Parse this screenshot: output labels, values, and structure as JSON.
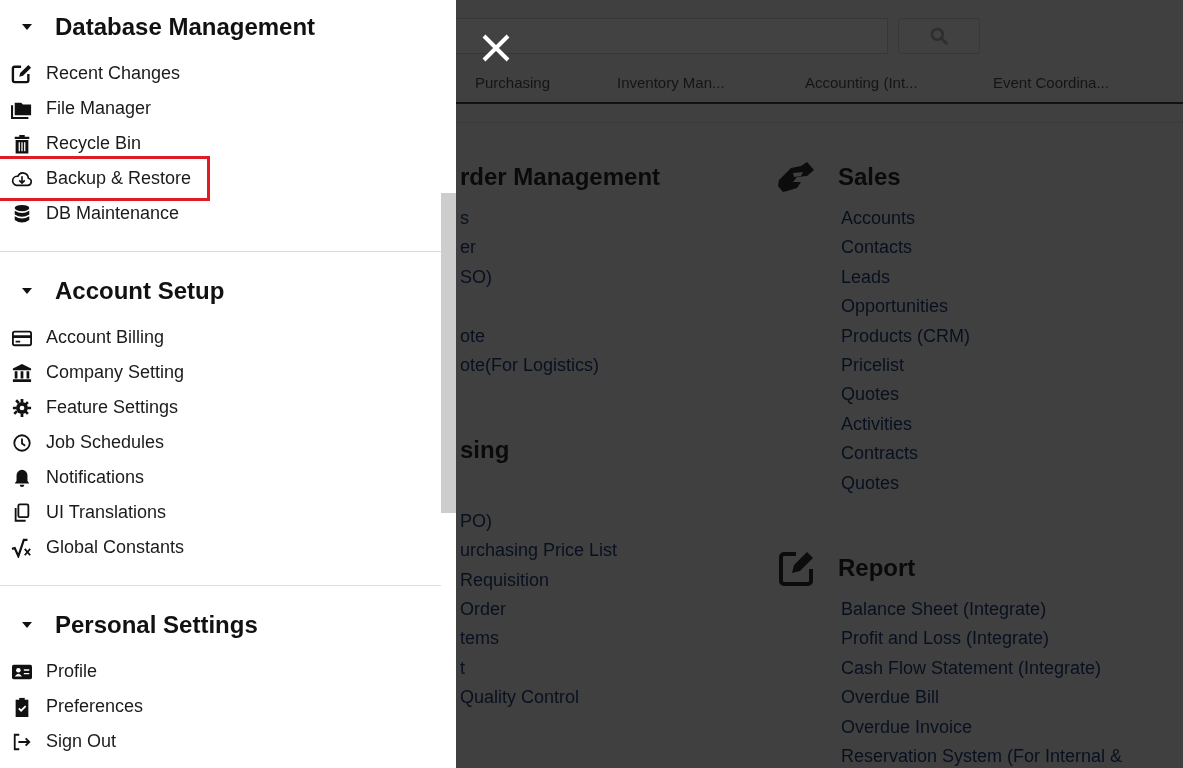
{
  "drawer": {
    "sections": [
      {
        "title": "Database Management",
        "expanded": true,
        "items": [
          {
            "label": "Recent Changes",
            "highlighted": false
          },
          {
            "label": "File Manager",
            "highlighted": false
          },
          {
            "label": "Recycle Bin",
            "highlighted": false
          },
          {
            "label": "Backup & Restore",
            "highlighted": true
          },
          {
            "label": "DB Maintenance",
            "highlighted": false
          }
        ]
      },
      {
        "title": "Account Setup",
        "expanded": true,
        "items": [
          {
            "label": "Account Billing",
            "highlighted": false
          },
          {
            "label": "Company Setting",
            "highlighted": false
          },
          {
            "label": "Feature Settings",
            "highlighted": false
          },
          {
            "label": "Job Schedules",
            "highlighted": false
          },
          {
            "label": "Notifications",
            "highlighted": false
          },
          {
            "label": "UI Translations",
            "highlighted": false
          },
          {
            "label": "Global Constants",
            "highlighted": false
          }
        ]
      },
      {
        "title": "Personal Settings",
        "expanded": true,
        "items": [
          {
            "label": "Profile",
            "highlighted": false
          },
          {
            "label": "Preferences",
            "highlighted": false
          },
          {
            "label": "Sign Out",
            "highlighted": false
          }
        ]
      }
    ]
  },
  "page": {
    "tabs": [
      {
        "label": "Purchasing",
        "selected": false
      },
      {
        "label": "Inventory Man...",
        "selected": false
      },
      {
        "label": "Accounting (Int...",
        "selected": false
      },
      {
        "label": "Event Coordina...",
        "selected": false
      }
    ],
    "left_column": [
      {
        "title": "rder Management",
        "links": [
          "s",
          "er",
          "SO)",
          "ote",
          "ote(For Logistics)"
        ]
      },
      {
        "title": "sing",
        "links": [
          "PO)",
          "urchasing Price List",
          "Requisition",
          "Order",
          "tems",
          "t",
          "Quality Control"
        ]
      }
    ],
    "right_column": [
      {
        "title": "Sales",
        "links": [
          "Accounts",
          "Contacts",
          "Leads",
          "Opportunities",
          "Products (CRM)",
          "Pricelist",
          "Quotes",
          "Activities",
          "Contracts",
          "Quotes"
        ]
      },
      {
        "title": "Report",
        "links": [
          "Balance Sheet (Integrate)",
          "Profit and Loss (Integrate)",
          "Cash Flow Statement (Integrate)",
          "Overdue Bill",
          "Overdue Invoice",
          "Reservation System (For Internal &"
        ]
      }
    ]
  }
}
